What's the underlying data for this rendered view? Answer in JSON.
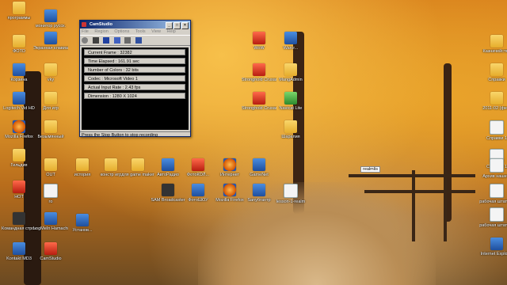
{
  "camstudio": {
    "title": "CamStudio",
    "menu": [
      "File",
      "Region",
      "Options",
      "Tools",
      "View",
      "Help"
    ],
    "stats": [
      "Current Frame : 32382",
      "Time Elapsed : 161.91 sec",
      "Number of Colors : 32 bits",
      "Codec : Microsoft Video 1",
      "Actual Input Rate : 2.43 fps",
      "Dimension : 1280 X 1024"
    ],
    "status": "Press the Stop Button to stop recording"
  },
  "desktop": {
    "icons": [
      {
        "name": "programs-icon",
        "label": "программы",
        "type": "folder"
      },
      {
        "name": "monitor-icon",
        "label": "монитор русск.",
        "type": "app"
      },
      {
        "name": "photo-icon",
        "label": "ФОТО",
        "type": "folder"
      },
      {
        "name": "screen-keyboard-icon",
        "label": "Экранная клавиатура",
        "type": "app"
      },
      {
        "name": "recycle-bin-icon",
        "label": "Корзина",
        "type": "app"
      },
      {
        "name": "vk-icon",
        "label": "vky",
        "type": "folder"
      },
      {
        "name": "logitech-icon",
        "label": "Logitech Vid HD",
        "type": "app"
      },
      {
        "name": "for-igr-icon",
        "label": "Для игр",
        "type": "folder"
      },
      {
        "name": "firefox-icon",
        "label": "Mozilla Firefox",
        "type": "fox"
      },
      {
        "name": "untitled-icon",
        "label": "Безымянный",
        "type": "folder"
      },
      {
        "name": "gilliya-icon",
        "label": "Гильдия",
        "type": "folder"
      },
      {
        "name": "out-icon",
        "label": "OUT",
        "type": "folder"
      },
      {
        "name": "hot-icon",
        "label": "НОТ",
        "type": "red"
      },
      {
        "name": "ro-icon",
        "label": "ro",
        "type": "doc"
      },
      {
        "name": "command-line-icon",
        "label": "Командная строка Wi...",
        "type": "dark"
      },
      {
        "name": "logmein-icon",
        "label": "LogMeIn Hamachi",
        "type": "app"
      },
      {
        "name": "kontakt-icon",
        "label": "Kontakt MD3",
        "type": "app"
      },
      {
        "name": "camstudio-icon",
        "label": "CamStudio",
        "type": "red"
      },
      {
        "name": "history-icon",
        "label": "история",
        "type": "folder"
      },
      {
        "name": "installer-icon",
        "label": "Установ...",
        "type": "app"
      },
      {
        "name": "construct-icon",
        "label": "констр игр",
        "type": "folder"
      },
      {
        "name": "game-maker-icon",
        "label": "для game maker",
        "type": "folder"
      },
      {
        "name": "autoradio-icon",
        "label": "АвтоРадио",
        "type": "app"
      },
      {
        "name": "fotokol-icon",
        "label": "ФотоКОЛ...",
        "type": "red"
      },
      {
        "name": "internet-icon",
        "label": "Интернет",
        "type": "fox"
      },
      {
        "name": "gamenet-icon",
        "label": "GameNet",
        "type": "app"
      },
      {
        "name": "sam-broadcaster-icon",
        "label": "SAM Broadcaster",
        "type": "dark"
      },
      {
        "name": "fotoshow-icon",
        "label": "ФотоШОУ",
        "type": "app"
      },
      {
        "name": "firefox2-icon",
        "label": "Mozilla Firefox",
        "type": "fox"
      },
      {
        "name": "sonybrain-icon",
        "label": "Sanyбrантр",
        "type": "app"
      },
      {
        "name": "lesson-realm-icon",
        "label": "lesson-1-realm",
        "type": "doc"
      },
      {
        "name": "stronghold-icon",
        "label": "Stronghold Crusader",
        "type": "red"
      },
      {
        "name": "stronghold2-icon",
        "label": "Stronghold Crusader",
        "type": "red"
      },
      {
        "name": "mangadmin-icon",
        "label": "MangAdmin",
        "type": "folder"
      },
      {
        "name": "navicat-icon",
        "label": "Navicat Lite",
        "type": "green"
      },
      {
        "name": "warcraft-icon",
        "label": "Warcr...",
        "type": "app"
      },
      {
        "name": "wow-icon",
        "label": "WoW",
        "type": "red"
      },
      {
        "name": "sharapiya-icon",
        "label": "Шарапия",
        "type": "folder"
      },
      {
        "name": "spravki-icon",
        "label": "Справки",
        "type": "folder"
      },
      {
        "name": "kaznacheystvo-icon",
        "label": "Казначейство",
        "type": "folder"
      },
      {
        "name": "spravki2-icon",
        "label": "Справки 1",
        "type": "doc"
      },
      {
        "name": "date-folder-icon",
        "label": "2011-02 (фев)",
        "type": "folder"
      },
      {
        "name": "spravki3-icon",
        "label": "Справки 1",
        "type": "doc"
      },
      {
        "name": "arhiv-icon",
        "label": "Архив нашего",
        "type": "doc"
      },
      {
        "name": "working-table-icon",
        "label": "рабочая штатка1",
        "type": "doc"
      },
      {
        "name": "working-table2-icon",
        "label": "рабочая штатка1",
        "type": "doc"
      },
      {
        "name": "ie-icon",
        "label": "Internet Explorer",
        "type": "app"
      }
    ],
    "realms_label": "realmlis"
  }
}
